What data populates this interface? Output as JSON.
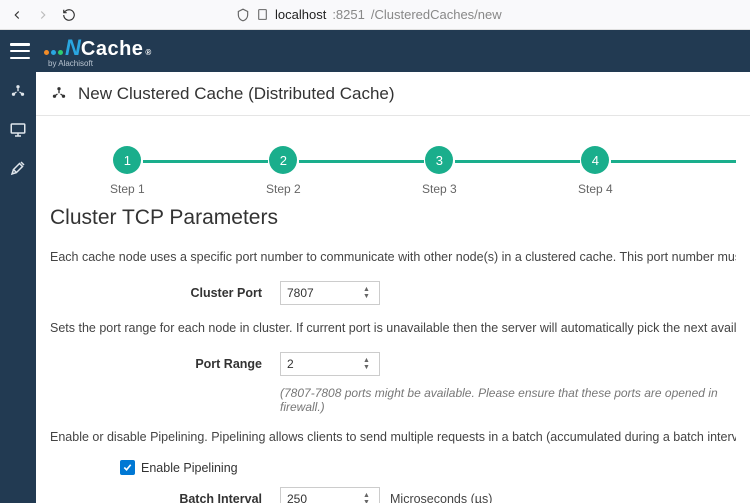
{
  "browser": {
    "url_host": "localhost",
    "url_port": ":8251",
    "url_path": "/ClusteredCaches/new"
  },
  "brand": {
    "name_first": "N",
    "name_rest": "Cache",
    "tm": "®",
    "sub": "by Alachisoft",
    "dot_colors": [
      "#f28c28",
      "#2aa6e0",
      "#2ecc71"
    ]
  },
  "page": {
    "title": "New Clustered Cache (Distributed Cache)"
  },
  "stepper": {
    "steps": [
      "Step 1",
      "Step 2",
      "Step 3",
      "Step 4"
    ],
    "numbers": [
      "1",
      "2",
      "3",
      "4"
    ]
  },
  "section": {
    "title": "Cluster TCP Parameters",
    "desc1": "Each cache node uses a specific port number to communicate with other node(s) in a clustered cache. This port number must be unique on every c",
    "cluster_port_label": "Cluster Port",
    "cluster_port_value": "7807",
    "desc2": "Sets the port range for each node in cluster. If current port is unavailable then the server will automatically pick the next available port in the pool.",
    "port_range_label": "Port Range",
    "port_range_value": "2",
    "port_range_hint": "(7807-7808 ports might be available. Please ensure that these ports are opened in firewall.)",
    "desc3": "Enable or disable Pipelining. Pipelining allows clients to send multiple requests in a batch (accumulated during a batch interval) using a single TCP",
    "enable_pipelining_label": "Enable Pipelining",
    "batch_interval_label": "Batch Interval",
    "batch_interval_value": "250",
    "batch_interval_unit": "Microseconds (µs)"
  }
}
